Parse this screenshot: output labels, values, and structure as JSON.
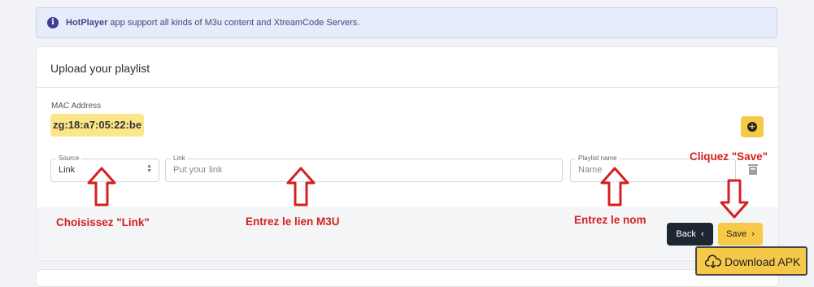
{
  "info_alert": {
    "brand": "HotPlayer",
    "text": " app support all kinds of M3u content and XtreamCode Servers."
  },
  "card": {
    "title": "Upload your playlist",
    "mac_label": "MAC Address",
    "mac_value": "zg:18:a7:05:22:be",
    "source": {
      "legend": "Source",
      "value": "Link"
    },
    "link": {
      "legend": "Link",
      "placeholder": "Put your link"
    },
    "playlist_name": {
      "legend": "Playlist name",
      "placeholder": "Name"
    },
    "back_label": "Back",
    "save_label": "Save"
  },
  "download": {
    "label": "Download APK"
  },
  "annotations": {
    "source": "Choisissez \"Link\"",
    "link": "Entrez le lien M3U",
    "name": "Entrez le nom",
    "save": "Cliquez \"Save\""
  },
  "colors": {
    "accent": "#f7c948",
    "annotation": "#d42020",
    "back_button": "#1f2633",
    "info_bg": "#e7ecfb"
  },
  "icons": [
    "info-icon",
    "plus-icon",
    "trash-icon",
    "chevron-left-icon",
    "chevron-right-icon",
    "cloud-download-icon",
    "up-down-chevron-icon",
    "arrow-up-icon",
    "arrow-down-icon"
  ]
}
